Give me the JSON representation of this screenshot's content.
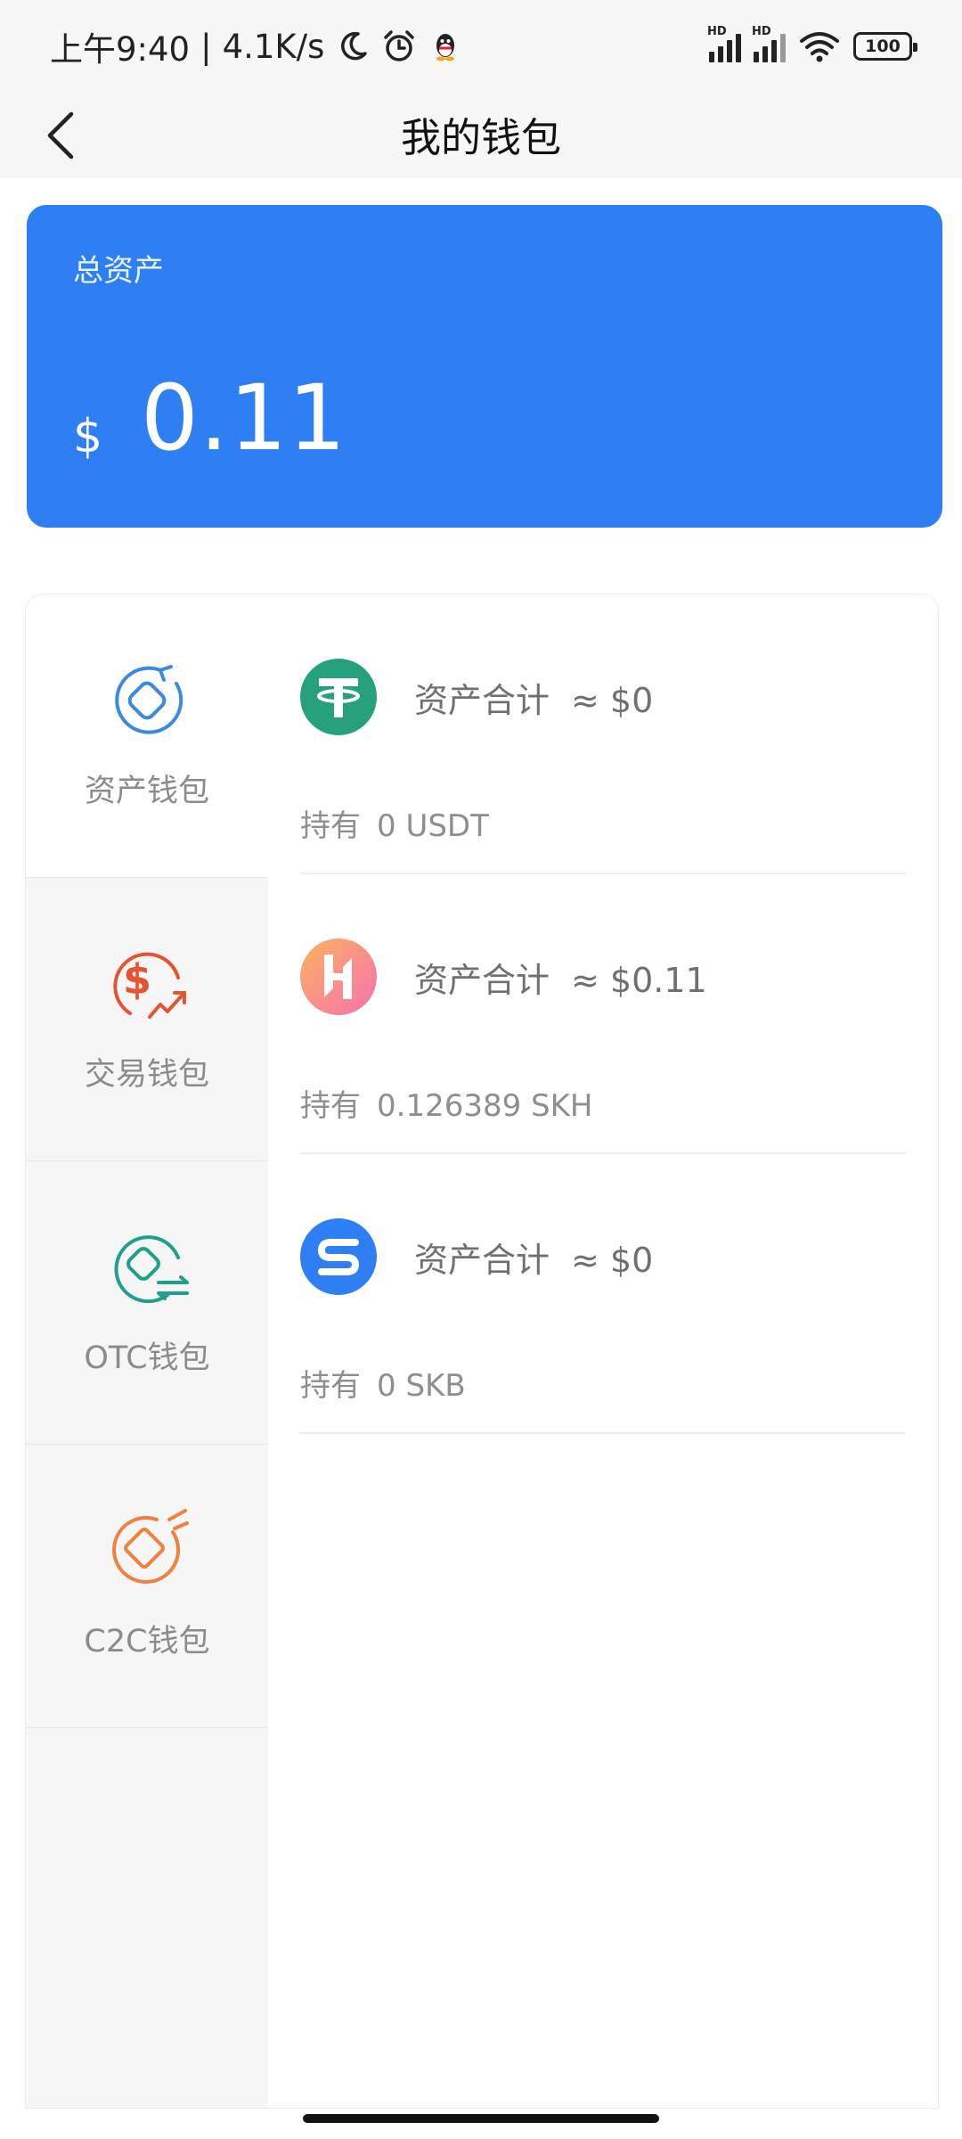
{
  "status_bar": {
    "time": "上午9:40",
    "separator": "|",
    "speed": "4.1K/s",
    "battery": "100",
    "signal_label": "HD",
    "icons": [
      "moon-icon",
      "alarm-icon",
      "qq-icon",
      "signal-icon",
      "wifi-icon",
      "battery-icon"
    ]
  },
  "header": {
    "title": "我的钱包",
    "back_icon": "chevron-left-icon"
  },
  "summary": {
    "label": "总资产",
    "currency": "$",
    "value": "0.11",
    "color": "#2f7ff4"
  },
  "wallets": [
    {
      "label": "资产钱包",
      "icon": "asset-wallet-icon",
      "color": "#3c8ae0",
      "active": true
    },
    {
      "label": "交易钱包",
      "icon": "trade-wallet-icon",
      "color": "#e35432",
      "active": false
    },
    {
      "label": "OTC钱包",
      "icon": "otc-wallet-icon",
      "color": "#1f9f8c",
      "active": false
    },
    {
      "label": "C2C钱包",
      "icon": "c2c-wallet-icon",
      "color": "#f0813f",
      "active": false
    }
  ],
  "assets": [
    {
      "coin_icon": "usdt-coin-icon",
      "total_label": "资产合计",
      "total_value": "≈ $0",
      "hold_label": "持有",
      "hold_value": "0 USDT",
      "color": "#26a17b"
    },
    {
      "coin_icon": "skh-coin-icon",
      "total_label": "资产合计",
      "total_value": "≈ $0.11",
      "hold_label": "持有",
      "hold_value": "0.126389 SKH",
      "color": "#f48db0"
    },
    {
      "coin_icon": "skb-coin-icon",
      "total_label": "资产合计",
      "total_value": "≈ $0",
      "hold_label": "持有",
      "hold_value": "0 SKB",
      "color": "#2f7ff4"
    }
  ]
}
